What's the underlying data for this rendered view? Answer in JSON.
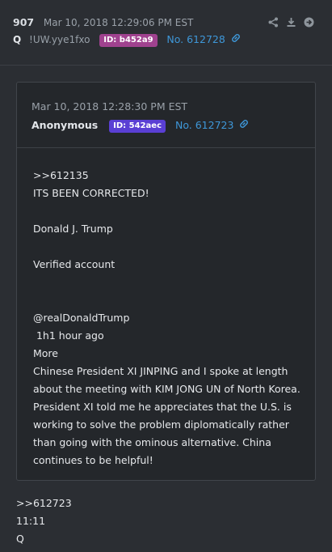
{
  "post": {
    "count": "907",
    "date": "Mar 10, 2018 12:29:06 PM EST",
    "author": "Q",
    "tripcode": "!UW.yye1fxo",
    "id_badge": "ID: b452a9",
    "id_color": "#a0428f",
    "number": "No. 612728"
  },
  "quote": {
    "date": "Mar 10, 2018 12:28:30 PM EST",
    "author": "Anonymous",
    "id_badge": "ID: 542aec",
    "id_color": "#5a3fd4",
    "number": "No. 612723",
    "body": ">>612135\nITS BEEN CORRECTED!\n\nDonald J. Trump\n\nVerified account\n\n\n@realDonaldTrump\n 1h1 hour ago\nMore\nChinese President XI JINPING and I spoke at length about the meeting with KIM JONG UN of North Korea. President XI told me he appreciates that the U.S. is working to solve the problem diplomatically rather than going with the ominous alternative. China continues to be helpful!"
  },
  "reply": {
    "body": ">>612723\n11:11\nQ"
  },
  "icons": [
    "share-icon",
    "download-icon",
    "goto-icon",
    "link-icon"
  ],
  "colors": {
    "link": "#3e97d8",
    "background": "#2b2e33",
    "card": "#24272b"
  }
}
